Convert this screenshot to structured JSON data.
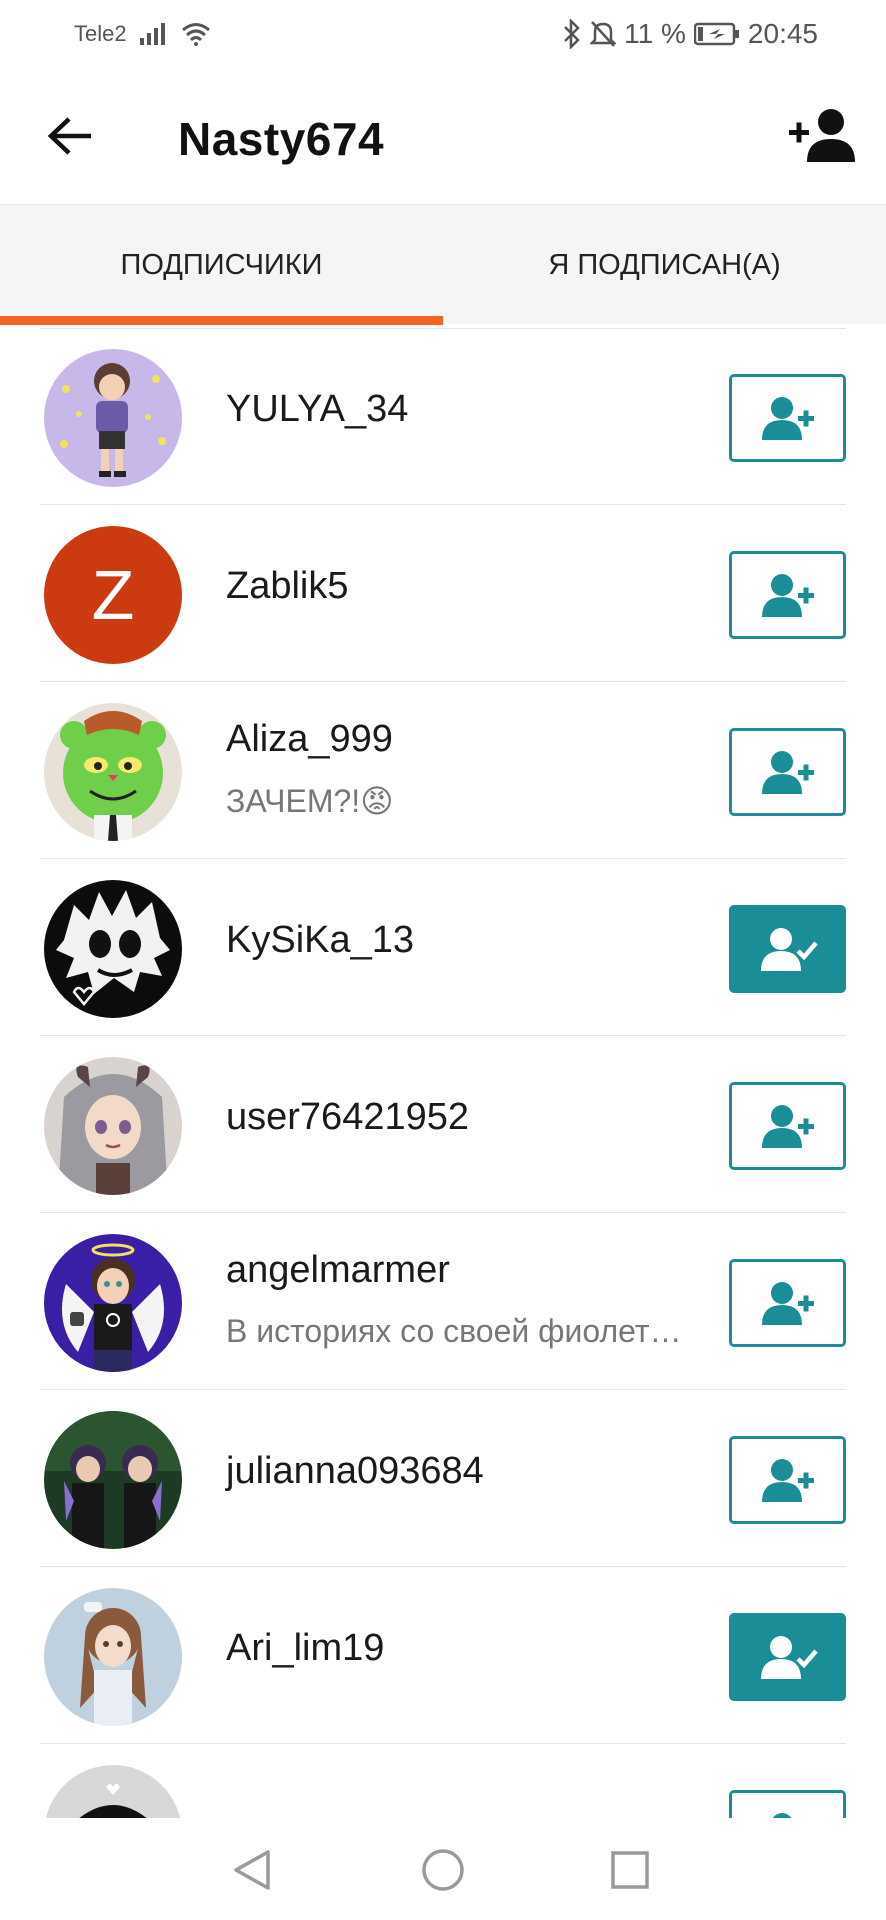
{
  "status_bar": {
    "carrier": "Tele2",
    "battery": "11 %",
    "time": "20:45"
  },
  "header": {
    "title": "Nasty674",
    "back_icon": "arrow-left-icon",
    "add_friend_icon": "add-person-icon"
  },
  "tabs": [
    {
      "label": "ПОДПИСЧИКИ",
      "active": true
    },
    {
      "label": "Я ПОДПИСАН(А)",
      "active": false
    }
  ],
  "colors": {
    "accent_orange": "#f26522",
    "teal": "#1a8d97",
    "zablik_avatar": "#cc3a12"
  },
  "users": [
    {
      "name": "YULYA_34",
      "bio": "",
      "following": false
    },
    {
      "name": "Zablik5",
      "bio": "",
      "following": false,
      "initial": "Z"
    },
    {
      "name": "Aliza_999",
      "bio": "ЗАЧЕМ?!😡",
      "following": false
    },
    {
      "name": "KySiKa_13",
      "bio": "",
      "following": true
    },
    {
      "name": "user76421952",
      "bio": "",
      "following": false
    },
    {
      "name": "angelmarmer",
      "bio": "В историях со своей фиолет…",
      "following": false
    },
    {
      "name": "julianna093684",
      "bio": "",
      "following": false
    },
    {
      "name": "Ari_lim19",
      "bio": "",
      "following": true
    },
    {
      "name": "",
      "bio": "",
      "following": false
    }
  ]
}
